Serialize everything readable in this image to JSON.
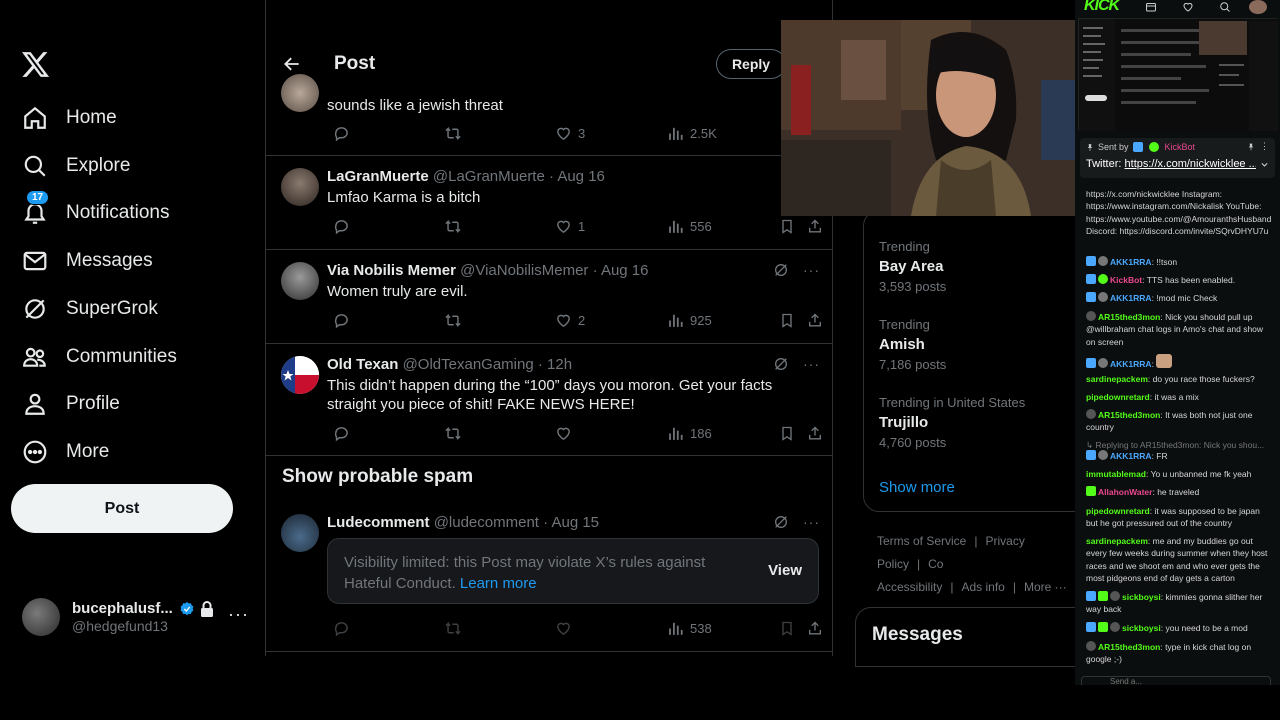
{
  "nav": {
    "items": [
      {
        "label": "Home",
        "icon": "home-icon"
      },
      {
        "label": "Explore",
        "icon": "search-icon"
      },
      {
        "label": "Notifications",
        "icon": "bell-icon",
        "badge": "17"
      },
      {
        "label": "Messages",
        "icon": "mail-icon"
      },
      {
        "label": "SuperGrok",
        "icon": "grok-icon"
      },
      {
        "label": "Communities",
        "icon": "communities-icon"
      },
      {
        "label": "Profile",
        "icon": "profile-icon"
      },
      {
        "label": "More",
        "icon": "more-circle-icon"
      }
    ],
    "post_button": "Post",
    "account": {
      "display_name": "bucephalusf...",
      "handle": "@hedgefund13"
    }
  },
  "header": {
    "title": "Post",
    "reply_button": "Reply"
  },
  "tweets": [
    {
      "name": "",
      "handle": "",
      "time": "",
      "text": "sounds like a jewish threat",
      "replies": "",
      "reposts": "",
      "likes": "3",
      "views": "2.5K"
    },
    {
      "name": "LaGranMuerte",
      "handle": "@LaGranMuerte",
      "time": "· Aug 16",
      "text": "Lmfao Karma is a bitch",
      "replies": "",
      "reposts": "",
      "likes": "1",
      "views": "556"
    },
    {
      "name": "Via Nobilis Memer",
      "handle": "@ViaNobilisMemer",
      "time": "· Aug 16",
      "text": "Women truly are evil.",
      "replies": "",
      "reposts": "",
      "likes": "2",
      "views": "925"
    },
    {
      "name": "Old Texan",
      "handle": "@OldTexanGaming",
      "time": "· 12h",
      "text": "This didn’t happen during the “100” days you moron. Get your facts straight you piece of shit! FAKE NEWS HERE!",
      "replies": "",
      "reposts": "",
      "likes": "",
      "views": "186"
    },
    {
      "name": "Ludecomment",
      "handle": "@ludecomment",
      "time": "· Aug 15",
      "text": "",
      "replies": "",
      "reposts": "",
      "likes": "",
      "views": "538"
    }
  ],
  "spam_section": {
    "title": "Show probable spam",
    "limited_text": "Visibility limited: this Post may violate X’s rules against Hateful Conduct.",
    "learn_more": "Learn more",
    "view_button": "View"
  },
  "trends": [
    {
      "context": "Trending",
      "name": "Bay Area",
      "count": "3,593 posts"
    },
    {
      "context": "Trending",
      "name": "Amish",
      "count": "7,186 posts"
    },
    {
      "context": "Trending in United States",
      "name": "Trujillo",
      "count": "4,760 posts"
    }
  ],
  "show_more": "Show more",
  "footer": [
    "Terms of Service",
    "|",
    "Privacy Policy",
    "|",
    "Co",
    "Accessibility",
    "|",
    "Ads info",
    "|",
    "More ···"
  ],
  "messages_drawer": "Messages",
  "kick": {
    "logo": "KICK",
    "pinned": {
      "sent_by": "Sent by",
      "sender": "KickBot",
      "text": "Twitter: ",
      "link": "https://x.com/nickwicklee ..."
    },
    "messages": [
      {
        "user": "",
        "text": "https://x.com/nickwicklee Instagram: https://www.instagram.com/Nickalisk YouTube: https://www.youtube.com/@AmouranthsHusband Discord: https://discord.com/invite/SQrvDHYU7u",
        "color": "#d6d6d6"
      },
      {
        "user": "AKK1RRA",
        "text": ": !!tson",
        "color": "#4aa8ff"
      },
      {
        "user": "KickBot",
        "text": ": TTS has been enabled.",
        "color": "#e9488f"
      },
      {
        "user": "AKK1RRA",
        "text": ": !mod mic Check",
        "color": "#4aa8ff"
      },
      {
        "user": "AR15thed3mon",
        "text": ": Nick you should pull up @willbraham chat logs in Amo's chat and show on screen",
        "color": "#53fc18"
      },
      {
        "user": "AKK1RRA",
        "text": ":",
        "color": "#4aa8ff"
      },
      {
        "user": "sardinepackem",
        "text": ": do you race those fuckers?",
        "color": "#53fc18"
      },
      {
        "user": "pipedownretard",
        "text": ": it was a mix",
        "color": "#53fc18"
      },
      {
        "user": "AR15thed3mon",
        "text": ": It was both not just one country",
        "color": "#53fc18"
      },
      {
        "user": "",
        "text": "↳ Replying to AR15thed3mon: Nick you shou...",
        "color": "#777"
      },
      {
        "user": "AKK1RRA",
        "text": ": FR",
        "color": "#4aa8ff"
      },
      {
        "user": "immutablemad",
        "text": ": Yo u unbanned me fk yeah",
        "color": "#53fc18"
      },
      {
        "user": "AllahonWater",
        "text": ": he traveled",
        "color": "#e9488f"
      },
      {
        "user": "pipedownretard",
        "text": ": it was supposed to be japan but he got pressured out of the country",
        "color": "#53fc18"
      },
      {
        "user": "sardinepackem",
        "text": ": me and my buddies go out every few weeks during summer when they host races and we shoot em and who ever gets the most pidgeons end of day gets a carton",
        "color": "#53fc18"
      },
      {
        "user": "sickboysi",
        "text": ": kimmies gonna slither her way back",
        "color": "#53fc18"
      },
      {
        "user": "sickboysi",
        "text": ": you need to be a mod",
        "color": "#53fc18"
      },
      {
        "user": "AR15thed3mon",
        "text": ": type in kick chat log on google ;-)",
        "color": "#53fc18"
      }
    ],
    "send_placeholder": "Send a..."
  }
}
